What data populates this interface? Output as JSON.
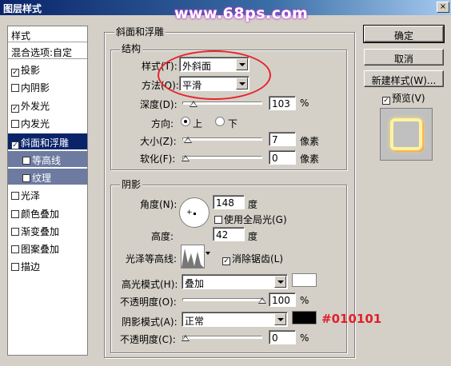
{
  "window": {
    "title": "图层样式",
    "close_glyph": "×"
  },
  "watermark": "www.68ps.com",
  "left_panel": {
    "header": "样式",
    "blend_options": "混合选项:自定",
    "items": [
      {
        "label": "投影",
        "checked": "✓"
      },
      {
        "label": "内阴影",
        "checked": ""
      },
      {
        "label": "外发光",
        "checked": "✓"
      },
      {
        "label": "内发光",
        "checked": ""
      },
      {
        "label": "斜面和浮雕",
        "checked": "✓"
      },
      {
        "label": "等高线",
        "checked": ""
      },
      {
        "label": "纹理",
        "checked": ""
      },
      {
        "label": "光泽",
        "checked": ""
      },
      {
        "label": "颜色叠加",
        "checked": ""
      },
      {
        "label": "渐变叠加",
        "checked": ""
      },
      {
        "label": "图案叠加",
        "checked": ""
      },
      {
        "label": "描边",
        "checked": ""
      }
    ]
  },
  "bevel": {
    "group_title": "斜面和浮雕",
    "structure": {
      "title": "结构",
      "style_label": "样式(T):",
      "style_value": "外斜面",
      "technique_label": "方法(Q):",
      "technique_value": "平滑",
      "depth_label": "深度(D):",
      "depth_value": "103",
      "depth_unit": "%",
      "depth_fraction": 0.1,
      "direction_label": "方向:",
      "direction_up": "上",
      "direction_down": "下",
      "size_label": "大小(Z):",
      "size_value": "7",
      "size_unit": "像素",
      "size_fraction": 0.03,
      "soften_label": "软化(F):",
      "soften_value": "0",
      "soften_unit": "像素",
      "soften_fraction": 0.0
    },
    "shading": {
      "title": "阴影",
      "angle_label": "角度(N):",
      "angle_value": "148",
      "angle_unit": "度",
      "global_light_label": "使用全局光(G)",
      "altitude_label": "高度:",
      "altitude_value": "42",
      "altitude_unit": "度",
      "gloss_contour_label": "光泽等高线:",
      "antialias_label": "消除锯齿(L)",
      "antialias_checked": "✓",
      "highlight_mode_label": "高光模式(H):",
      "highlight_mode_value": "叠加",
      "highlight_color": "#ffffff",
      "highlight_opacity_label": "不透明度(O):",
      "highlight_opacity_value": "100",
      "highlight_opacity_unit": "%",
      "highlight_opacity_fraction": 1.0,
      "shadow_mode_label": "阴影模式(A):",
      "shadow_mode_value": "正常",
      "shadow_color": "#010101",
      "shadow_opacity_label": "不透明度(C):",
      "shadow_opacity_value": "0",
      "shadow_opacity_unit": "%",
      "shadow_opacity_fraction": 0.0
    }
  },
  "buttons": {
    "ok": "确定",
    "cancel": "取消",
    "new_style": "新建样式(W)...",
    "preview_label": "预览(V)",
    "preview_checked": "✓"
  },
  "annotation": "#010101"
}
